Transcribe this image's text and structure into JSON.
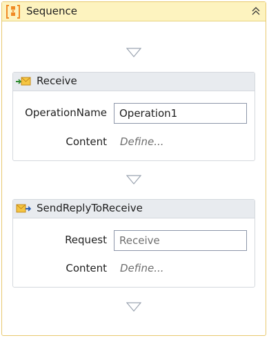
{
  "sequence": {
    "title": "Sequence",
    "icon": "sequence-icon",
    "collapse_icon": "double-chevron-up-icon"
  },
  "receive": {
    "title": "Receive",
    "icon": "receive-message-icon",
    "fields": {
      "operation_name_label": "OperationName",
      "operation_name_value": "Operation1",
      "content_label": "Content",
      "content_link": "Define..."
    }
  },
  "send_reply": {
    "title": "SendReplyToReceive",
    "icon": "send-message-icon",
    "fields": {
      "request_label": "Request",
      "request_value": "Receive",
      "content_label": "Content",
      "content_link": "Define..."
    }
  },
  "colors": {
    "sequence_header": "#fdf3bf",
    "sequence_border": "#e8c86e",
    "activity_header": "#e8ebef",
    "activity_border": "#d4d8dd",
    "accent_orange": "#f08a24"
  }
}
